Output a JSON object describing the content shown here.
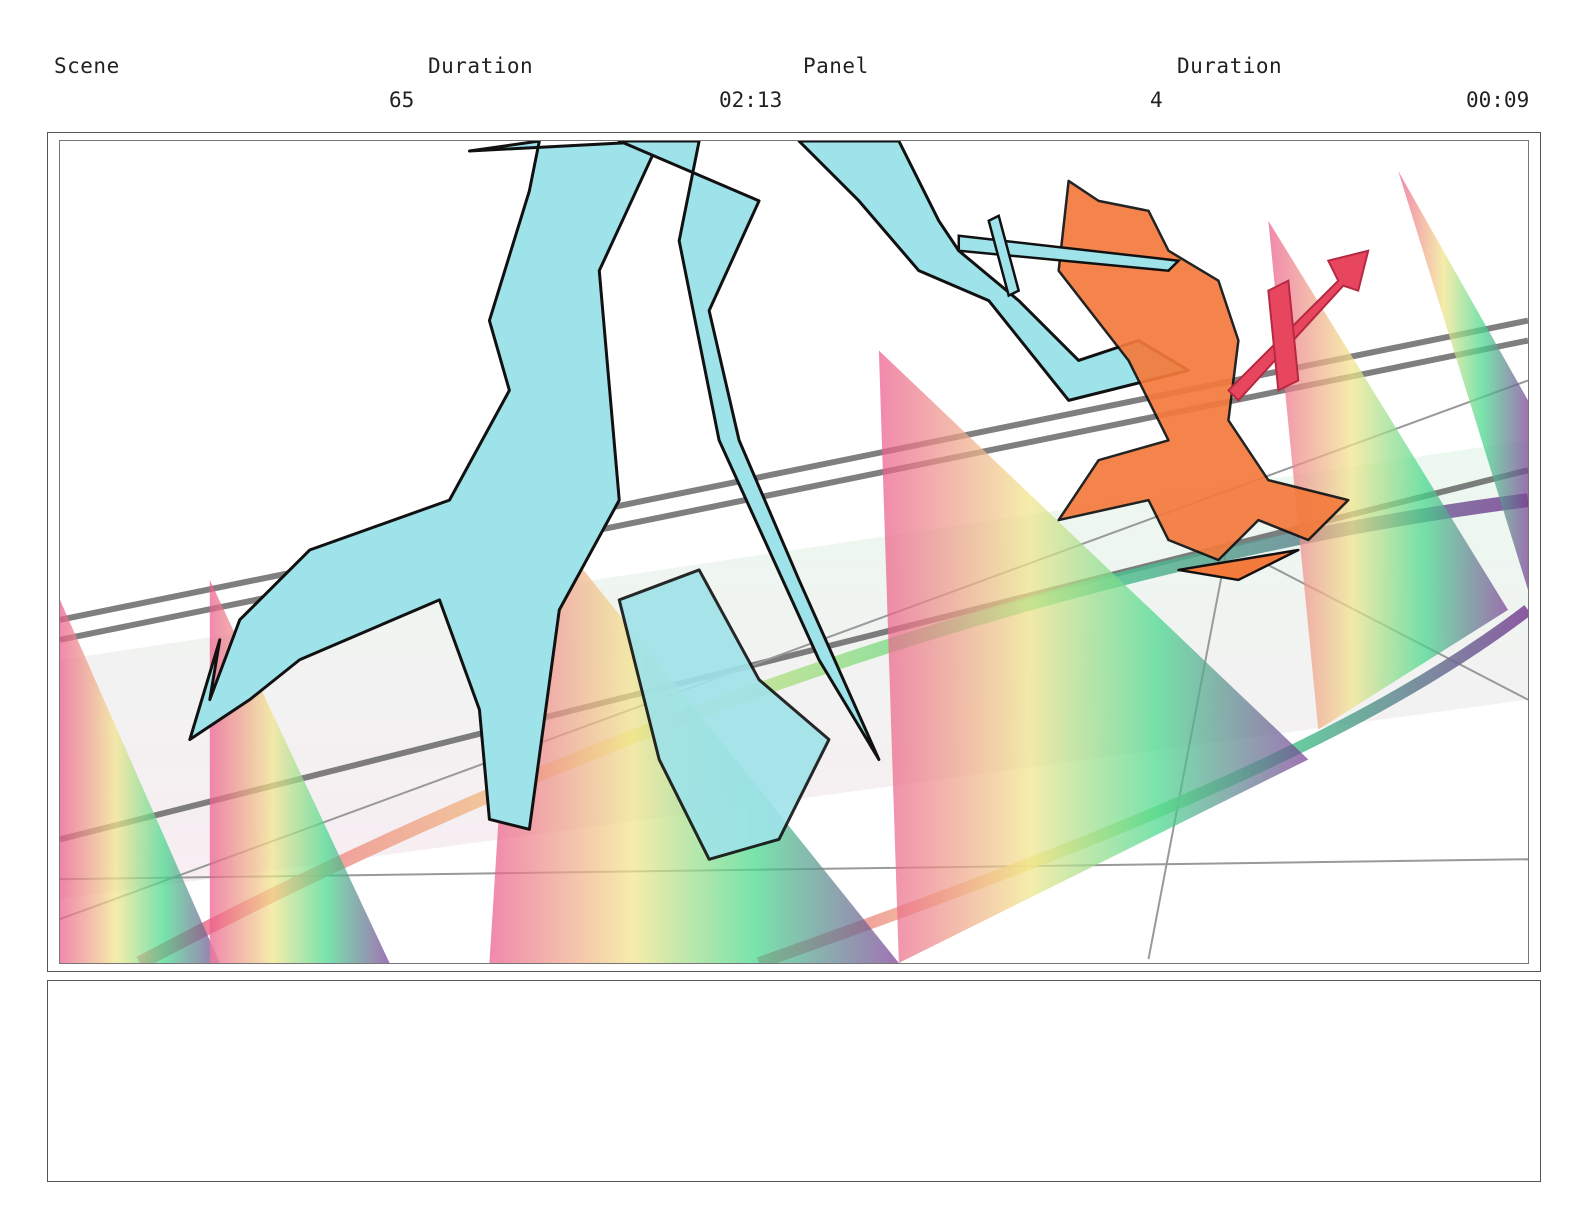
{
  "header": {
    "scene_label": "Scene",
    "scene_duration_label": "Duration",
    "panel_label": "Panel",
    "panel_duration_label": "Duration",
    "scene_number": "65",
    "scene_duration": "02:13",
    "panel_number": "4",
    "panel_duration": "00:09"
  },
  "artwork": {
    "colors": {
      "creature": "#9fe3ea",
      "character": "#f47a3c",
      "weapon": "#e8465f",
      "outline": "#111111"
    }
  },
  "notes": {
    "text": ""
  }
}
